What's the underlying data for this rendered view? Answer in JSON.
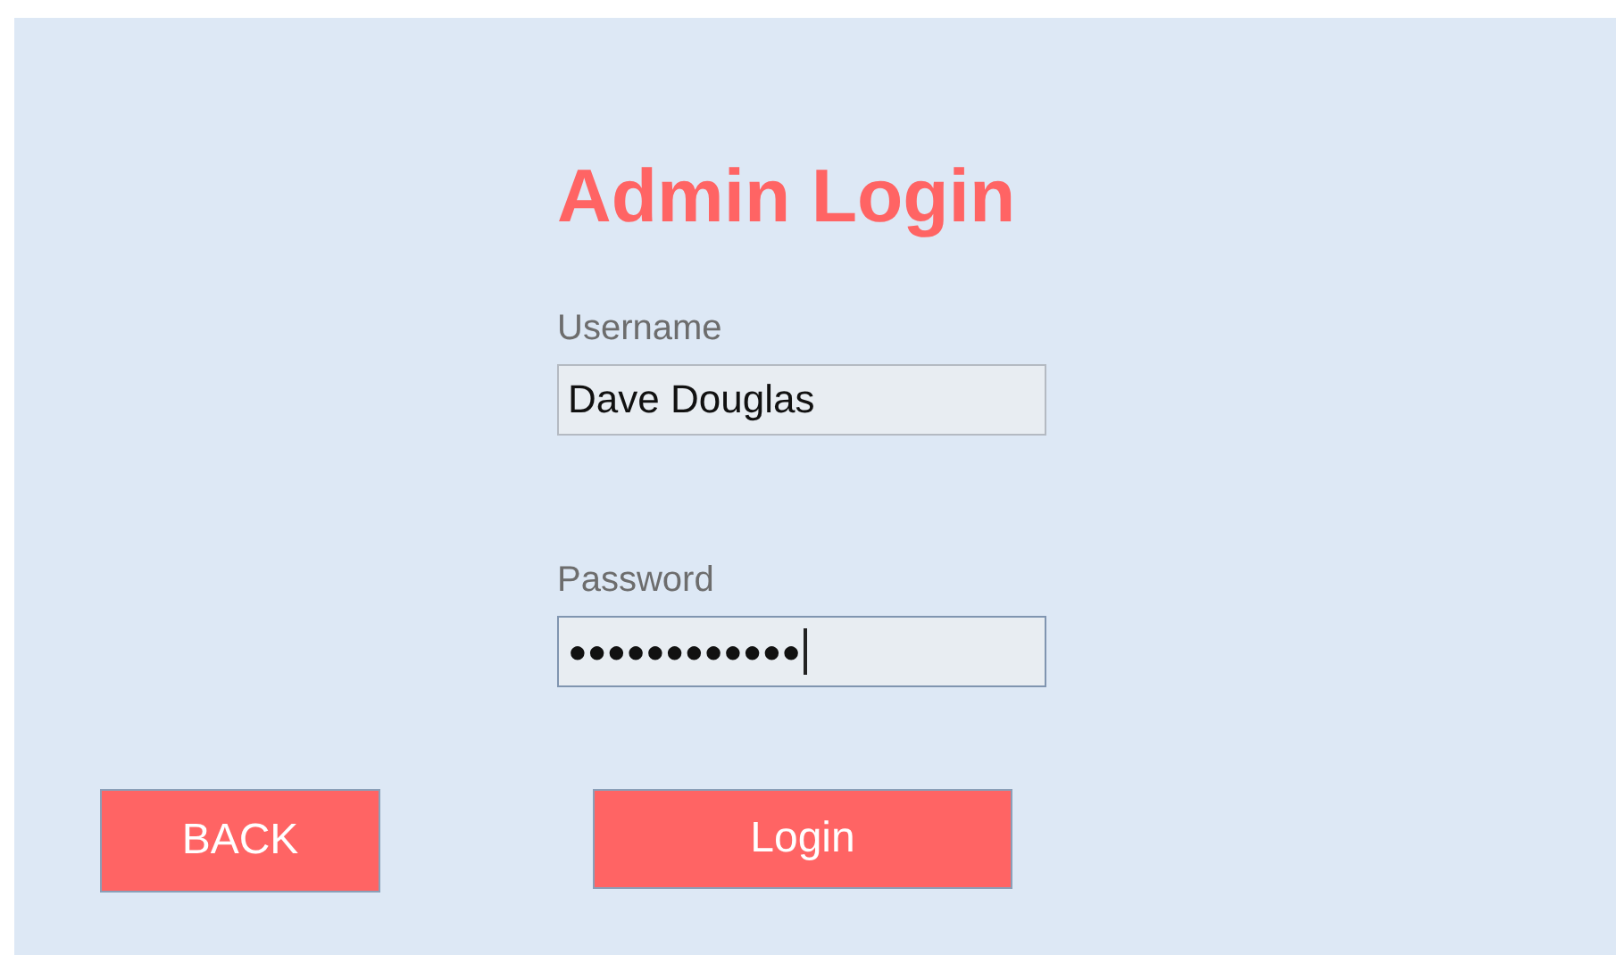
{
  "title": "Admin Login",
  "fields": [
    {
      "label": "Username",
      "value": "Dave Douglas",
      "focused": false
    },
    {
      "label": "Password",
      "value": "●●●●●●●●●●●●",
      "focused": true
    }
  ],
  "buttons": [
    {
      "label": "BACK"
    },
    {
      "label": "Login"
    }
  ]
}
